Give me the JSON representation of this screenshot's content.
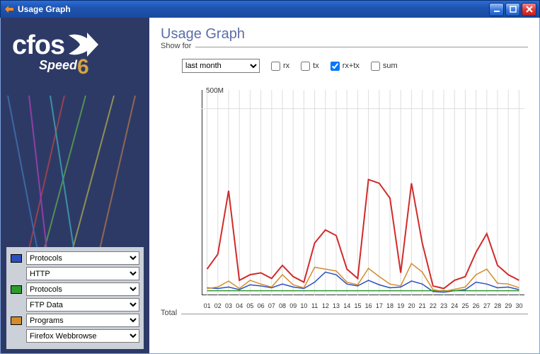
{
  "window": {
    "title": "Usage Graph"
  },
  "logo": {
    "main": "cfos",
    "sub": "Speed",
    "version": "6"
  },
  "legend": {
    "rows": [
      {
        "swatch": "#2a4fbf",
        "category": "Protocols",
        "value": "HTTP"
      },
      {
        "swatch": "#2d9a2d",
        "category": "Protocols",
        "value": "FTP Data"
      },
      {
        "swatch": "#d48b2a",
        "category": "Programs",
        "value": "Firefox Webbrowse"
      }
    ]
  },
  "page": {
    "title": "Usage Graph",
    "showfor_label": "Show for",
    "period": "last month",
    "checks": {
      "rx": "rx",
      "tx": "tx",
      "rxtx": "rx+tx",
      "sum": "sum"
    },
    "total_label": "Total"
  },
  "chart_data": {
    "type": "line",
    "ylabel": "500M",
    "ylim": [
      0,
      550
    ],
    "categories": [
      "01",
      "02",
      "03",
      "04",
      "05",
      "06",
      "07",
      "08",
      "09",
      "10",
      "11",
      "12",
      "13",
      "14",
      "15",
      "16",
      "17",
      "18",
      "19",
      "20",
      "21",
      "22",
      "23",
      "24",
      "25",
      "26",
      "27",
      "28",
      "29",
      "30"
    ],
    "series": [
      {
        "name": "HTTP",
        "color": "#2a4fbf",
        "values": [
          20,
          18,
          22,
          15,
          28,
          25,
          20,
          30,
          22,
          18,
          35,
          62,
          55,
          30,
          25,
          40,
          28,
          20,
          22,
          38,
          30,
          10,
          8,
          12,
          15,
          35,
          30,
          20,
          22,
          15
        ]
      },
      {
        "name": "FTP Data",
        "color": "#2d9a2d",
        "values": [
          12,
          12,
          12,
          12,
          12,
          12,
          12,
          12,
          12,
          12,
          12,
          12,
          12,
          12,
          12,
          12,
          12,
          12,
          12,
          12,
          12,
          12,
          12,
          12,
          12,
          12,
          12,
          12,
          12,
          12
        ]
      },
      {
        "name": "Firefox",
        "color": "#d48b2a",
        "values": [
          18,
          22,
          38,
          18,
          40,
          30,
          22,
          55,
          28,
          20,
          75,
          70,
          65,
          35,
          28,
          72,
          50,
          30,
          25,
          85,
          62,
          15,
          10,
          16,
          22,
          55,
          70,
          32,
          30,
          20
        ]
      },
      {
        "name": "rx+tx",
        "color": "#d22a2a",
        "values": [
          70,
          110,
          280,
          40,
          55,
          60,
          45,
          80,
          50,
          35,
          140,
          175,
          160,
          70,
          45,
          310,
          300,
          260,
          60,
          300,
          140,
          25,
          18,
          40,
          50,
          115,
          165,
          80,
          55,
          40
        ]
      }
    ]
  }
}
